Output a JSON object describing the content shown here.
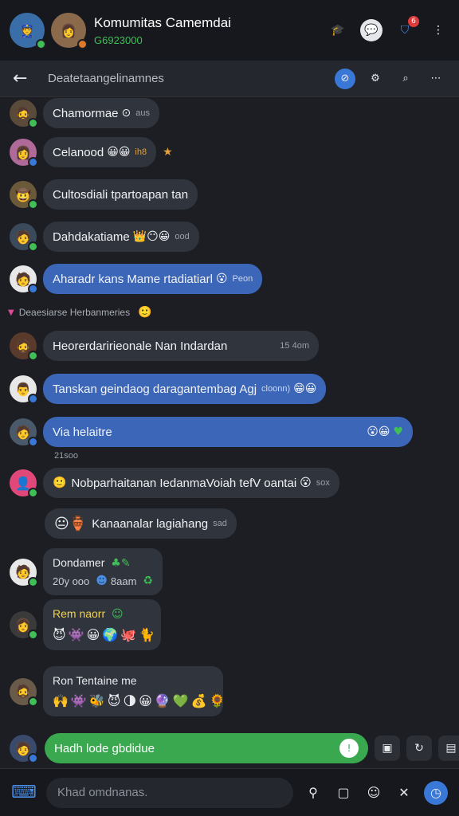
{
  "header": {
    "title": "Komumitas Camemdai",
    "subtitle": "G6923000",
    "notification_count": "6"
  },
  "subheader": {
    "title": "Deatetaangelinamnes"
  },
  "messages": [
    {
      "text": "Chamormae",
      "meta": "aus"
    },
    {
      "text": "Celanood",
      "meta": "ih8"
    },
    {
      "text": "Cultosdiali tpartoapan tan",
      "meta": ""
    },
    {
      "text": "Dahdakatiame",
      "meta": "ood"
    },
    {
      "text": "Aharadr kans Mame rtadiatiarl",
      "meta": "Peon"
    },
    {
      "text": "Heorerdaririeonale Nan Indardan",
      "meta": "15 4om"
    },
    {
      "text": "Tanskan geindaog daragantembag Agj",
      "meta": "cloonn)"
    },
    {
      "text": "Via helaitre",
      "meta": ""
    },
    {
      "text": "Nobparhaitanan IedanmaVoiah tefV oantai",
      "meta": "sox"
    },
    {
      "text": "Kanaanalar lagiahang",
      "meta": "sad"
    }
  ],
  "date_separator": "Deaesiarse Herbanmeries",
  "time_label": "21soo",
  "cards": [
    {
      "title": "Dondamer",
      "line2": "20y ooo",
      "line2b": "8aam"
    },
    {
      "title": "Rem naorr"
    },
    {
      "title": "Ron Tentaine me"
    }
  ],
  "compose": {
    "pill_text": "Hadh lode gbdidue",
    "placeholder": "Khad omdnanas."
  },
  "icons": {
    "back": "arrow-left-icon",
    "more": "more-vertical-icon"
  },
  "colors": {
    "accent_blue": "#3a78d8",
    "accent_green": "#39a84f",
    "badge_red": "#e03b3b"
  }
}
